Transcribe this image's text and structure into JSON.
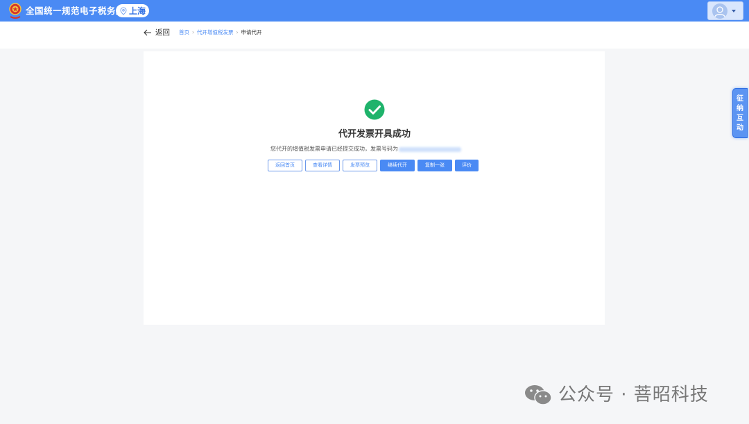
{
  "header": {
    "site_title": "全国统一规范电子税务局",
    "location": "上海"
  },
  "nav": {
    "back_label": "返回",
    "breadcrumb": [
      "首页",
      "代开增值税发票",
      "申请代开"
    ],
    "breadcrumb_sep": "›"
  },
  "result": {
    "title": "代开发票开具成功",
    "message": "您代开的增值税发票申请已经提交成功，发票号码为",
    "buttons": {
      "back_home": "返回首页",
      "view_detail": "查看详情",
      "preview": "发票预览",
      "continue": "继续代开",
      "copy": "复制一张",
      "rate": "评价"
    }
  },
  "side_tab": {
    "chars": [
      "征",
      "纳",
      "互",
      "动"
    ]
  },
  "watermark": {
    "text": "公众号 · 菩昭科技"
  },
  "colors": {
    "primary": "#4a8af4",
    "success": "#1fb36b"
  }
}
